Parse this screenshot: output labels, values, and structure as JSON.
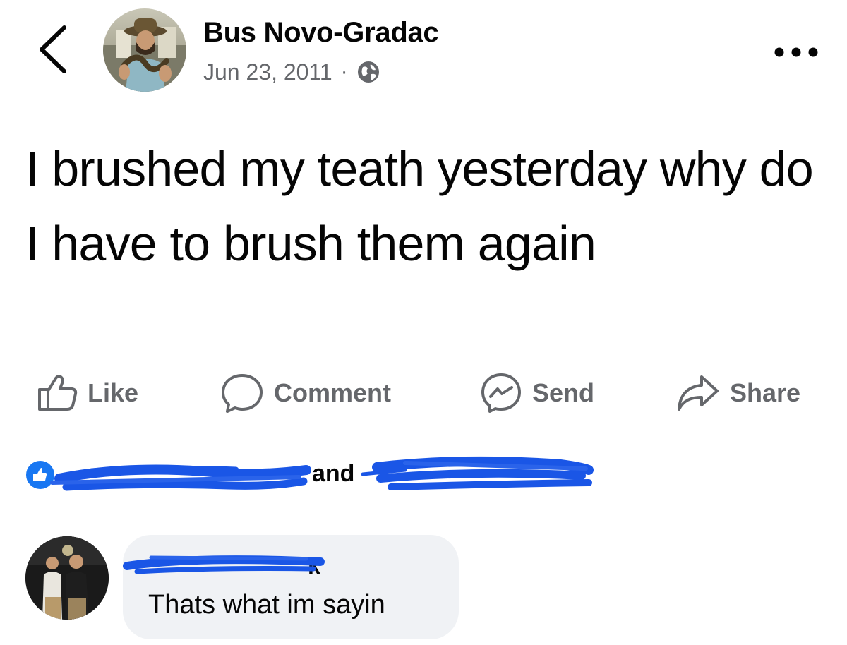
{
  "post": {
    "author": "Bus Novo-Gradac",
    "date": "Jun 23, 2011",
    "separator": "·",
    "audience_icon": "globe-icon",
    "text": "I brushed my teath yesterday why do I have to brush them again"
  },
  "actions": {
    "like": "Like",
    "comment": "Comment",
    "send": "Send",
    "share": "Share"
  },
  "reactions": {
    "icon": "like-badge-icon",
    "connector": "and"
  },
  "comment": {
    "author_visible_fragment": "k",
    "text": "Thats what im sayin"
  },
  "colors": {
    "text_primary": "#050505",
    "text_secondary": "#65676b",
    "brand_blue": "#1877f2",
    "bubble_bg": "#f0f2f5",
    "redaction_blue": "#1a56e6"
  }
}
